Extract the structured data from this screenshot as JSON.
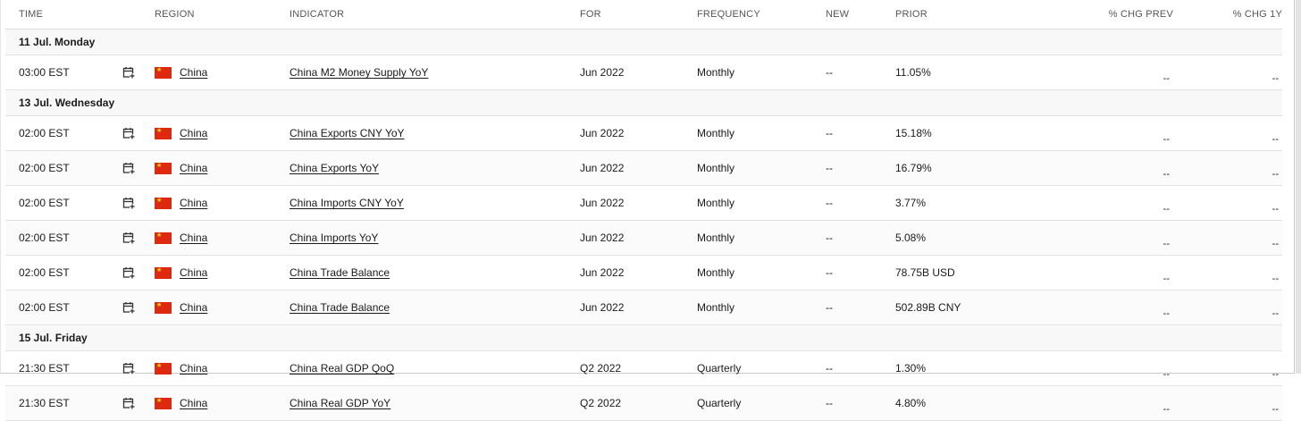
{
  "headers": {
    "time": "TIME",
    "region": "REGION",
    "indicator": "INDICATOR",
    "for": "FOR",
    "frequency": "FREQUENCY",
    "new": "NEW",
    "prior": "PRIOR",
    "chg_prev": "% CHG PREV",
    "chg_1y": "% CHG 1Y"
  },
  "groups": [
    {
      "date": "11 Jul. Monday",
      "rows": [
        {
          "time": "03:00 EST",
          "region": "China",
          "indicator": "China M2 Money Supply YoY",
          "for": "Jun 2022",
          "frequency": "Monthly",
          "new": "--",
          "prior": "11.05%",
          "chg_prev": "--",
          "chg_1y": "--"
        }
      ]
    },
    {
      "date": "13 Jul. Wednesday",
      "rows": [
        {
          "time": "02:00 EST",
          "region": "China",
          "indicator": "China Exports CNY YoY",
          "for": "Jun 2022",
          "frequency": "Monthly",
          "new": "--",
          "prior": "15.18%",
          "chg_prev": "--",
          "chg_1y": "--"
        },
        {
          "time": "02:00 EST",
          "region": "China",
          "indicator": "China Exports YoY",
          "for": "Jun 2022",
          "frequency": "Monthly",
          "new": "--",
          "prior": "16.79%",
          "chg_prev": "--",
          "chg_1y": "--"
        },
        {
          "time": "02:00 EST",
          "region": "China",
          "indicator": "China Imports CNY YoY",
          "for": "Jun 2022",
          "frequency": "Monthly",
          "new": "--",
          "prior": "3.77%",
          "chg_prev": "--",
          "chg_1y": "--"
        },
        {
          "time": "02:00 EST",
          "region": "China",
          "indicator": "China Imports YoY",
          "for": "Jun 2022",
          "frequency": "Monthly",
          "new": "--",
          "prior": "5.08%",
          "chg_prev": "--",
          "chg_1y": "--"
        },
        {
          "time": "02:00 EST",
          "region": "China",
          "indicator": "China Trade Balance",
          "for": "Jun 2022",
          "frequency": "Monthly",
          "new": "--",
          "prior": "78.75B USD",
          "chg_prev": "--",
          "chg_1y": "--"
        },
        {
          "time": "02:00 EST",
          "region": "China",
          "indicator": "China Trade Balance",
          "for": "Jun 2022",
          "frequency": "Monthly",
          "new": "--",
          "prior": "502.89B CNY",
          "chg_prev": "--",
          "chg_1y": "--"
        }
      ]
    },
    {
      "date": "15 Jul. Friday",
      "rows": [
        {
          "time": "21:30 EST",
          "region": "China",
          "indicator": "China Real GDP QoQ",
          "for": "Q2 2022",
          "frequency": "Quarterly",
          "new": "--",
          "prior": "1.30%",
          "chg_prev": "--",
          "chg_1y": "--"
        },
        {
          "time": "21:30 EST",
          "region": "China",
          "indicator": "China Real GDP YoY",
          "for": "Q2 2022",
          "frequency": "Quarterly",
          "new": "--",
          "prior": "4.80%",
          "chg_prev": "--",
          "chg_1y": "--"
        }
      ]
    }
  ],
  "icons": {
    "calendar": "calendar-add-icon",
    "flag": "china-flag-icon"
  },
  "colors": {
    "flag_red": "#de2910",
    "flag_star": "#ffde00",
    "date_row_bg": "#f8f8f8"
  }
}
